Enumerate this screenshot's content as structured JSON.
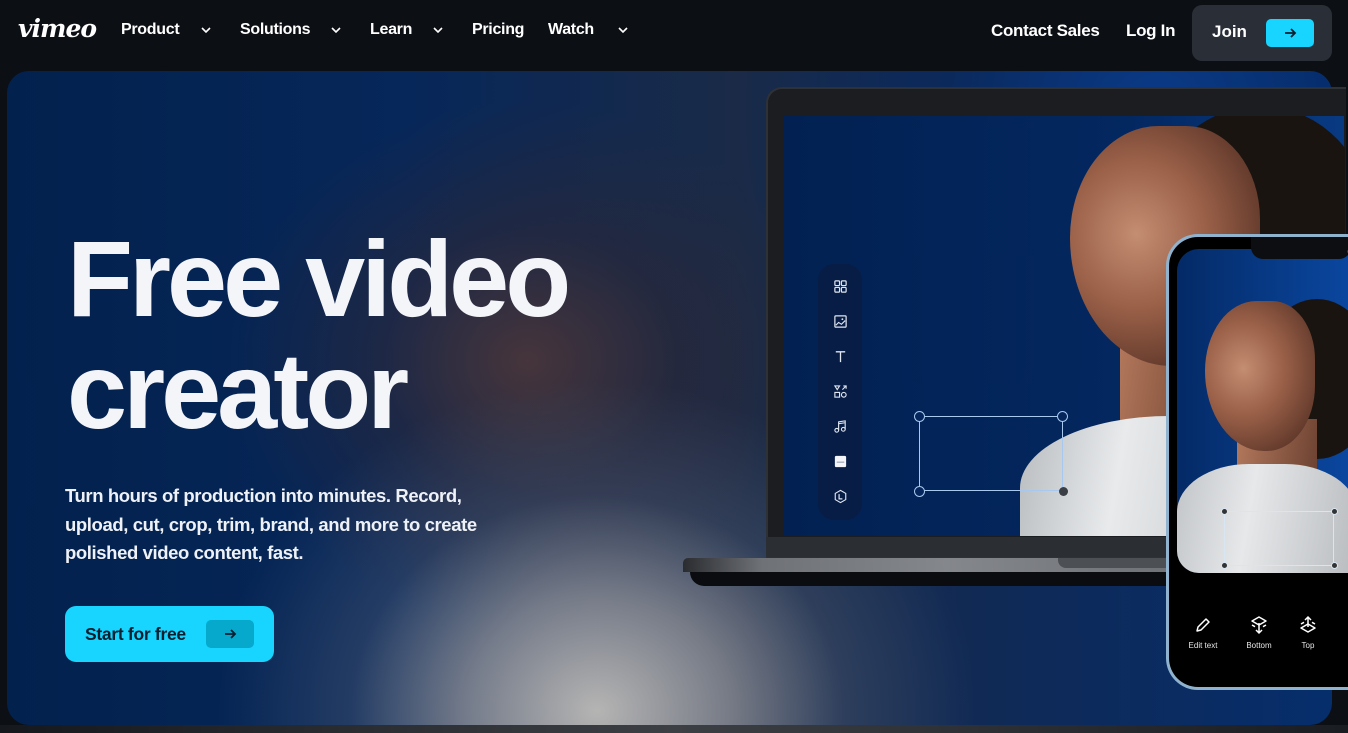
{
  "nav": {
    "logo": "vimeo",
    "items": [
      {
        "label": "Product",
        "has_dropdown": true
      },
      {
        "label": "Solutions",
        "has_dropdown": true
      },
      {
        "label": "Learn",
        "has_dropdown": true
      },
      {
        "label": "Pricing",
        "has_dropdown": false
      },
      {
        "label": "Watch",
        "has_dropdown": true
      }
    ],
    "contact_sales": "Contact Sales",
    "log_in": "Log In",
    "join": "Join",
    "join_icon": "arrow-right-icon"
  },
  "hero": {
    "title_line1": "Free video",
    "title_line2": "creator",
    "description": "Turn hours of production into minutes. Record, upload, cut, crop, trim, brand, and more to create polished video content, fast.",
    "cta_label": "Start for free",
    "cta_icon": "arrow-right-icon"
  },
  "editor_mockup": {
    "tools": [
      "grid-icon",
      "image-icon",
      "text-icon",
      "elements-icon",
      "music-icon",
      "caption-icon",
      "logo-icon"
    ],
    "phone_actions": [
      {
        "label": "Edit text",
        "icon": "pencil-icon"
      },
      {
        "label": "Bottom",
        "icon": "layer-bottom-icon"
      },
      {
        "label": "Top",
        "icon": "layer-top-icon"
      }
    ]
  },
  "colors": {
    "accent": "#17d5ff",
    "nav_bg": "#0c0f14",
    "join_bg": "#2a2f37",
    "hero_blue": "#03214d"
  }
}
